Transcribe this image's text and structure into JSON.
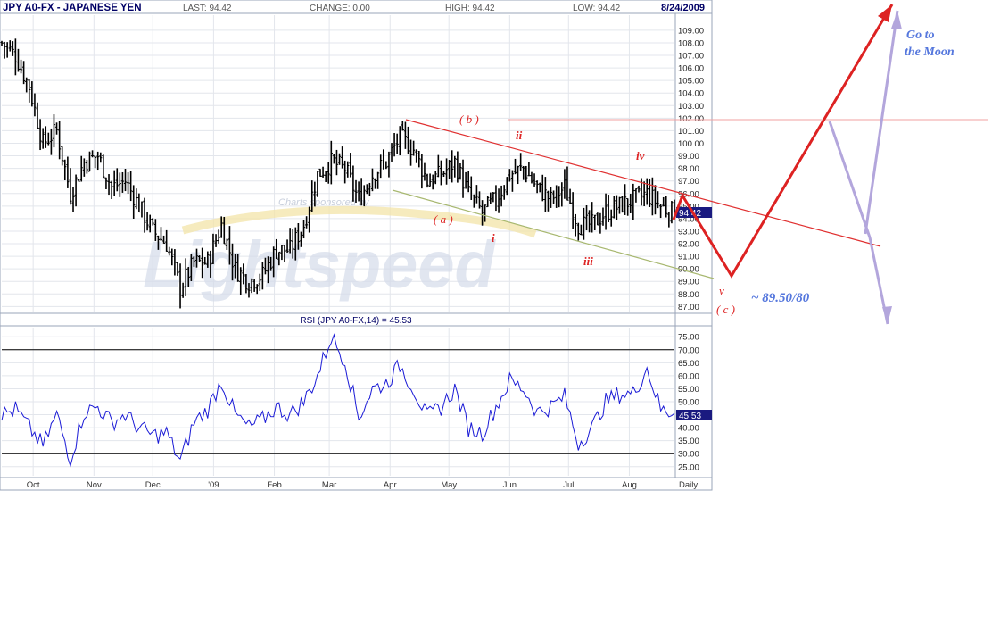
{
  "header": {
    "symbol": "JPY A0-FX - JAPANESE YEN",
    "last": "LAST: 94.42",
    "change": "CHANGE: 0.00",
    "high": "HIGH: 94.42",
    "low": "LOW: 94.42",
    "date": "8/24/2009"
  },
  "sponsor_text": "Charts sponsored by",
  "watermark": "Lightspeed",
  "last_price_badge": "94.42",
  "rsi_label": "RSI (JPY A0-FX,14) = 45.53",
  "rsi_value_badge": "45.53",
  "x_labels": [
    "Oct",
    "Nov",
    "Dec",
    "'09",
    "Feb",
    "Mar",
    "Apr",
    "May",
    "Jun",
    "Jul",
    "Aug"
  ],
  "period_label": "Daily",
  "annotations": {
    "b": "( b )",
    "a": "( a )",
    "ii": "ii",
    "i": "i",
    "iii": "iii",
    "iv": "iv",
    "v": "v",
    "c": "( c )",
    "target": "~ 89.50/80",
    "moon": [
      "Go to",
      "the Moon"
    ]
  },
  "colors": {
    "header_text": "#555555",
    "title": "#000066",
    "price": "#000000",
    "rsi_line": "#1a1ad6",
    "projection": "#dd2222",
    "alt_projection": "#b3a6dc",
    "channel_upper": "#e03030",
    "channel_lower": "#a8b870",
    "annotation_red": "#dd2222",
    "annotation_blue": "#5577dd",
    "badge_bg": "#1a1a80"
  },
  "chart_data": [
    {
      "type": "candlestick",
      "title": "JPY A0-FX - JAPANESE YEN",
      "x_range": [
        "2008-09-15",
        "2009-08-24"
      ],
      "y_ticks": [
        87,
        88,
        89,
        90,
        91,
        92,
        93,
        94,
        95,
        96,
        97,
        98,
        99,
        100,
        101,
        102,
        103,
        104,
        105,
        106,
        107,
        108,
        109
      ],
      "y_tick_labels": [
        "87.00",
        "88.00",
        "89.00",
        "90.00",
        "91.00",
        "92.00",
        "93.00",
        "94.00",
        "95.00",
        "96.00",
        "97.00",
        "98.00",
        "99.00",
        "100.00",
        "101.00",
        "102.00",
        "103.00",
        "104.00",
        "105.00",
        "106.00",
        "107.00",
        "108.00",
        "109.00"
      ],
      "ylim": [
        86.6,
        110.2
      ],
      "close_path": [
        [
          "2008-09-15",
          108.0
        ],
        [
          "2008-09-22",
          107.0
        ],
        [
          "2008-09-29",
          104.5
        ],
        [
          "2008-10-06",
          100.0
        ],
        [
          "2008-10-13",
          101.0
        ],
        [
          "2008-10-20",
          96.0
        ],
        [
          "2008-10-27",
          98.5
        ],
        [
          "2008-11-03",
          99.0
        ],
        [
          "2008-11-10",
          96.5
        ],
        [
          "2008-11-17",
          97.0
        ],
        [
          "2008-11-24",
          95.0
        ],
        [
          "2008-12-01",
          93.0
        ],
        [
          "2008-12-08",
          92.0
        ],
        [
          "2008-12-15",
          88.5
        ],
        [
          "2008-12-22",
          90.5
        ],
        [
          "2008-12-29",
          90.5
        ],
        [
          "2009-01-05",
          93.5
        ],
        [
          "2009-01-12",
          90.0
        ],
        [
          "2009-01-19",
          89.0
        ],
        [
          "2009-01-26",
          89.5
        ],
        [
          "2009-02-02",
          91.5
        ],
        [
          "2009-02-09",
          91.5
        ],
        [
          "2009-02-16",
          93.5
        ],
        [
          "2009-02-23",
          97.5
        ],
        [
          "2009-03-02",
          98.5
        ],
        [
          "2009-03-09",
          98.0
        ],
        [
          "2009-03-16",
          95.5
        ],
        [
          "2009-03-23",
          97.5
        ],
        [
          "2009-03-30",
          98.5
        ],
        [
          "2009-04-06",
          100.5
        ],
        [
          "2009-04-13",
          99.5
        ],
        [
          "2009-04-20",
          97.0
        ],
        [
          "2009-04-27",
          97.5
        ],
        [
          "2009-05-04",
          98.5
        ],
        [
          "2009-05-11",
          96.0
        ],
        [
          "2009-05-18",
          94.5
        ],
        [
          "2009-05-25",
          95.5
        ],
        [
          "2009-06-01",
          97.5
        ],
        [
          "2009-06-08",
          98.0
        ],
        [
          "2009-06-15",
          96.5
        ],
        [
          "2009-06-22",
          95.5
        ],
        [
          "2009-06-29",
          96.5
        ],
        [
          "2009-07-06",
          93.5
        ],
        [
          "2009-07-13",
          93.5
        ],
        [
          "2009-07-20",
          94.5
        ],
        [
          "2009-07-27",
          95.0
        ],
        [
          "2009-08-03",
          95.5
        ],
        [
          "2009-08-10",
          96.0
        ],
        [
          "2009-08-17",
          95.0
        ],
        [
          "2009-08-24",
          94.42
        ]
      ],
      "last": 94.42,
      "annotations": [
        "( b )",
        "( a )",
        "ii",
        "i",
        "iii",
        "iv",
        "v",
        "( c )",
        "~ 89.50/80",
        "Go to the Moon"
      ]
    },
    {
      "type": "line",
      "title": "RSI (JPY A0-FX,14) = 45.53",
      "x_range": [
        "2008-09-15",
        "2009-08-24"
      ],
      "y_ticks": [
        25,
        30,
        35,
        40,
        45,
        50,
        55,
        60,
        65,
        70,
        75
      ],
      "y_tick_labels": [
        "25.00",
        "30.00",
        "35.00",
        "40.00",
        "45.00",
        "50.00",
        "55.00",
        "60.00",
        "65.00",
        "70.00",
        "75.00"
      ],
      "reference_lines": [
        70,
        30
      ],
      "ylim": [
        21.5,
        78.5
      ],
      "series": [
        {
          "values": [
            [
              "2008-09-15",
              45
            ],
            [
              "2008-09-22",
              47
            ],
            [
              "2008-09-29",
              40
            ],
            [
              "2008-10-06",
              33
            ],
            [
              "2008-10-13",
              45
            ],
            [
              "2008-10-20",
              28
            ],
            [
              "2008-10-27",
              46
            ],
            [
              "2008-11-03",
              48
            ],
            [
              "2008-11-10",
              42
            ],
            [
              "2008-11-17",
              45
            ],
            [
              "2008-11-24",
              40
            ],
            [
              "2008-12-01",
              37
            ],
            [
              "2008-12-08",
              38
            ],
            [
              "2008-12-15",
              27
            ],
            [
              "2008-12-22",
              42
            ],
            [
              "2008-12-29",
              47
            ],
            [
              "2009-01-05",
              58
            ],
            [
              "2009-01-12",
              45
            ],
            [
              "2009-01-19",
              40
            ],
            [
              "2009-01-26",
              43
            ],
            [
              "2009-02-02",
              48
            ],
            [
              "2009-02-09",
              45
            ],
            [
              "2009-02-16",
              50
            ],
            [
              "2009-02-23",
              60
            ],
            [
              "2009-03-02",
              75
            ],
            [
              "2009-03-09",
              66
            ],
            [
              "2009-03-16",
              44
            ],
            [
              "2009-03-23",
              55
            ],
            [
              "2009-03-30",
              57
            ],
            [
              "2009-04-06",
              64
            ],
            [
              "2009-04-13",
              55
            ],
            [
              "2009-04-20",
              44
            ],
            [
              "2009-04-27",
              48
            ],
            [
              "2009-05-04",
              55
            ],
            [
              "2009-05-11",
              40
            ],
            [
              "2009-05-18",
              38
            ],
            [
              "2009-05-25",
              48
            ],
            [
              "2009-06-01",
              58
            ],
            [
              "2009-06-08",
              55
            ],
            [
              "2009-06-15",
              46
            ],
            [
              "2009-06-22",
              48
            ],
            [
              "2009-06-29",
              52
            ],
            [
              "2009-07-06",
              34
            ],
            [
              "2009-07-13",
              40
            ],
            [
              "2009-07-20",
              50
            ],
            [
              "2009-07-27",
              53
            ],
            [
              "2009-08-03",
              53
            ],
            [
              "2009-08-10",
              63
            ],
            [
              "2009-08-17",
              47
            ],
            [
              "2009-08-24",
              45.53
            ]
          ]
        }
      ]
    }
  ]
}
